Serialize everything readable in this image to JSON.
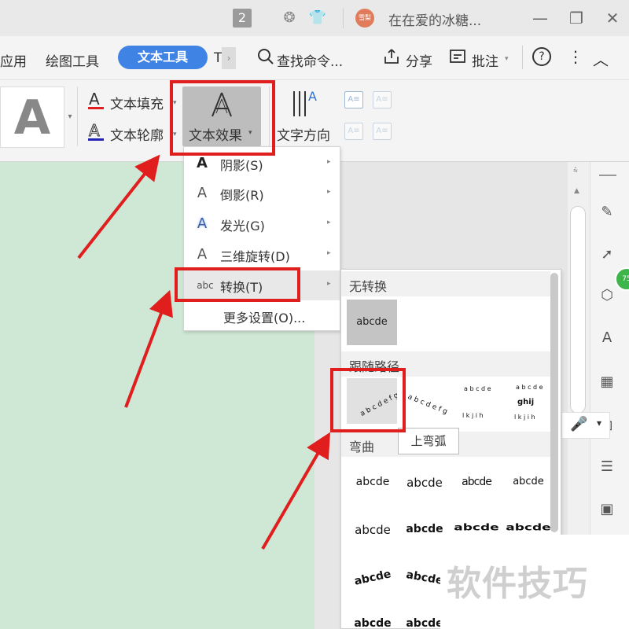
{
  "titlebar": {
    "tab_count": "2",
    "user_name": "在在爱的冰糖...",
    "avatar_text": "雪梨"
  },
  "menubar": {
    "items": [
      "应用",
      "绘图工具",
      "文本工具",
      "T"
    ],
    "search": "查找命令...",
    "share": "分享",
    "comment": "批注",
    "help": "?",
    "more": "⋮",
    "collapse": "︿"
  },
  "ribbon": {
    "style_preview": "A",
    "text_fill": "文本填充",
    "text_outline": "文本轮廓",
    "text_effect": "文本效果",
    "text_direction": "文字方向"
  },
  "effect_menu": {
    "items": [
      {
        "label": "阴影(S)",
        "icon": "shadow-a-icon",
        "arrow": "▸"
      },
      {
        "label": "倒影(R)",
        "icon": "reflection-a-icon",
        "arrow": "▸"
      },
      {
        "label": "发光(G)",
        "icon": "glow-a-icon",
        "arrow": "▸"
      },
      {
        "label": "三维旋转(D)",
        "icon": "rotate-3d-a-icon",
        "arrow": "▸"
      },
      {
        "label": "转换(T)",
        "icon": "abc-icon",
        "arrow": "▸"
      },
      {
        "label": "更多设置(O)...",
        "icon": "",
        "arrow": ""
      }
    ],
    "abc_icon_text": "abc"
  },
  "transform_panel": {
    "section_none": "无转换",
    "none_sample": "abcde",
    "section_path": "跟随路径",
    "path_samples": [
      "abcdefg",
      "abcdefg",
      "abcdefghijkl",
      "abcdefghijkl"
    ],
    "path_center_text": "ghij",
    "section_warp": "弯曲",
    "warp_rows": [
      [
        "abcde",
        "abcde",
        "abcde",
        "abcde"
      ],
      [
        "abcde",
        "abcde",
        "abcde",
        "abcde"
      ],
      [
        "abcde",
        "abcde"
      ],
      [
        "abcde",
        "abcde"
      ]
    ],
    "tooltip": "上弯弧"
  },
  "sidebar": {
    "badge": "75"
  },
  "watermark": "软件技巧",
  "colors": {
    "accent": "#3f84e5",
    "highlight": "#e01e1e",
    "doc_bg": "#cfe7d5"
  }
}
